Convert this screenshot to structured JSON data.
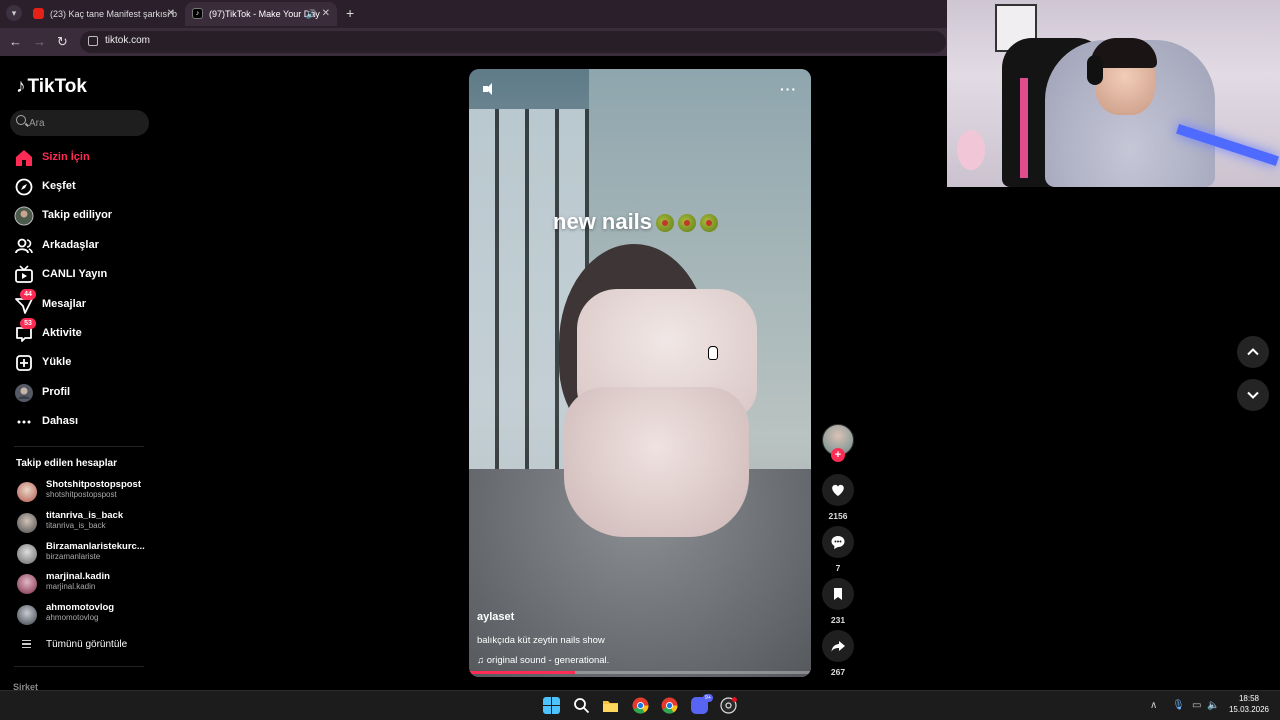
{
  "browser": {
    "tabs": [
      {
        "title": "(23) Kaç tane Manifest şarkısı b",
        "favicon": "youtube-icon"
      },
      {
        "title": "(97)TikTok - Make Your Day",
        "favicon": "tiktok-icon"
      }
    ],
    "url": "tiktok.com"
  },
  "tiktok": {
    "logo_text": "TikTok",
    "search": {
      "placeholder": "Ara"
    },
    "nav": [
      {
        "label": "Sizin İçin",
        "icon": "home-icon",
        "active": true
      },
      {
        "label": "Keşfet",
        "icon": "compass-icon"
      },
      {
        "label": "Takip ediliyor",
        "icon": "following-avatar-icon"
      },
      {
        "label": "Arkadaşlar",
        "icon": "friends-icon"
      },
      {
        "label": "CANLI Yayın",
        "icon": "live-tv-icon"
      },
      {
        "label": "Mesajlar",
        "icon": "messages-icon",
        "badge": "44"
      },
      {
        "label": "Aktivite",
        "icon": "activity-icon",
        "badge": "53"
      },
      {
        "label": "Yükle",
        "icon": "upload-icon"
      },
      {
        "label": "Profil",
        "icon": "profile-avatar-icon"
      },
      {
        "label": "Dahası",
        "icon": "more-dots-icon"
      }
    ],
    "following_title": "Takip edilen hesaplar",
    "following": [
      {
        "name": "Shotshitpostopspost",
        "handle": "shotshitpostopspost"
      },
      {
        "name": "titanriva_is_back",
        "handle": "titanriva_is_back"
      },
      {
        "name": "Birzamanlaristekurc...",
        "handle": "birzamanlariste"
      },
      {
        "name": "marjinal.kadin",
        "handle": "marjinal.kadin"
      },
      {
        "name": "ahmomotovlog",
        "handle": "ahmomotovlog"
      }
    ],
    "see_all": "Tümünü görüntüle",
    "company_label": "Şirket",
    "video": {
      "overlay_text": "new nails",
      "author": "aylaset",
      "description": "balıkçıda küt zeytin nails show",
      "music": "original sound - generational.",
      "progress": 0.31
    },
    "actions": {
      "likes": "2156",
      "comments": "7",
      "saves": "231",
      "shares": "267"
    }
  },
  "taskbar": {
    "discord_badge": "9+",
    "time": "18:58",
    "date": "15.03.2026"
  },
  "colors": {
    "accent": "#fe2c55",
    "tab_strip": "#2a1f2b",
    "toolbar": "#3b2c3c",
    "taskbar": "#1c1c1c"
  }
}
